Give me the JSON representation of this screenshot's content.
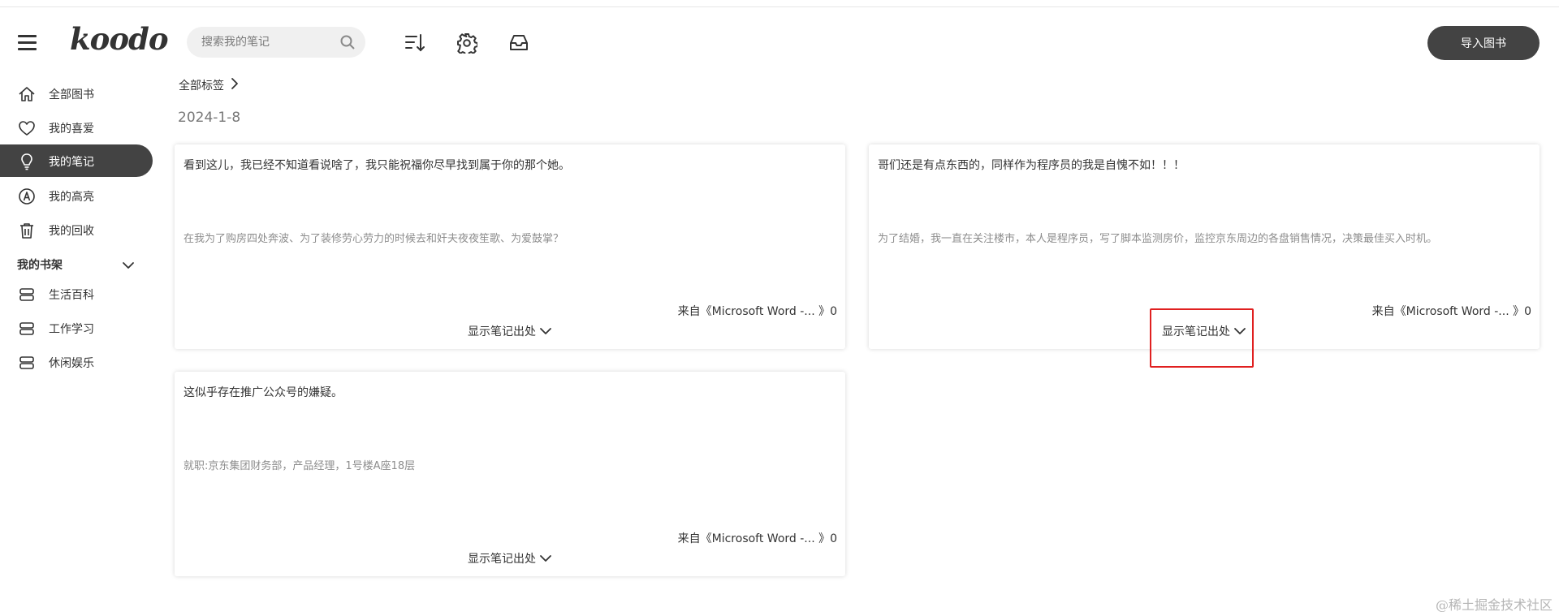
{
  "header": {
    "logo": "koodo",
    "search_placeholder": "搜索我的笔记",
    "import_label": "导入图书",
    "tools": [
      "sort-icon",
      "settings-gear-icon",
      "inbox-tray-icon"
    ]
  },
  "sidebar": {
    "items": [
      {
        "label": "全部图书",
        "icon": "home-icon",
        "active": false
      },
      {
        "label": "我的喜爱",
        "icon": "heart-icon",
        "active": false
      },
      {
        "label": "我的笔记",
        "icon": "lightbulb-icon",
        "active": true
      },
      {
        "label": "我的高亮",
        "icon": "highlight-circle-a-icon",
        "active": false
      },
      {
        "label": "我的回收",
        "icon": "trash-icon",
        "active": false
      }
    ],
    "shelf_title": "我的书架",
    "shelves": [
      {
        "label": "生活百科",
        "icon": "shelf-icon"
      },
      {
        "label": "工作学习",
        "icon": "shelf-icon"
      },
      {
        "label": "休闲娱乐",
        "icon": "shelf-icon"
      }
    ]
  },
  "main": {
    "breadcrumb": "全部标签",
    "date": "2024-1-8",
    "show_source_label": "显示笔记出处",
    "cards": [
      {
        "note": "看到这儿，我已经不知道看说啥了，我只能祝福你尽早找到属于你的那个她。",
        "quote": "在我为了购房四处奔波、为了装修劳心劳力的时候去和奸夫夜夜笙歌、为爱鼓掌？",
        "source": "来自《Microsoft Word -... 》0"
      },
      {
        "note": "哥们还是有点东西的，同样作为程序员的我是自愧不如！！！",
        "quote": "为了结婚，我一直在关注楼市，本人是程序员，写了脚本监测房价，监控京东周边的各盘销售情况，决策最佳买入时机。",
        "source": "来自《Microsoft Word -... 》0"
      },
      {
        "note": "这似乎存在推广公众号的嫌疑。",
        "quote": "就职:京东集团财务部，产品经理，1号楼A座18层",
        "source": "来自《Microsoft Word -... 》0"
      }
    ]
  },
  "watermark": "@稀土掘金技术社区",
  "colors": {
    "accent_dark": "#434343",
    "highlight_red": "#e02020",
    "muted_text": "#8d8d8d"
  }
}
